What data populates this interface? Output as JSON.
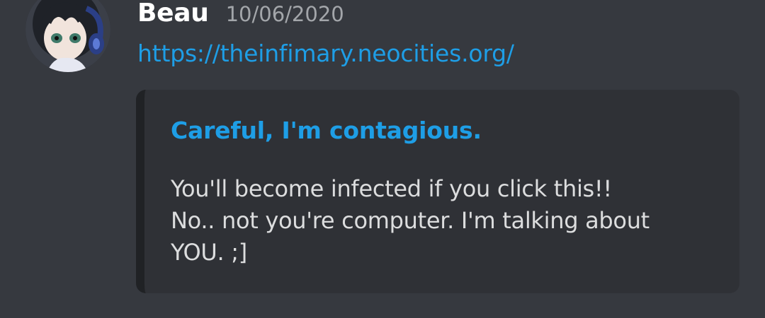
{
  "message": {
    "author": {
      "name": "Beau",
      "avatar_icon": "anime-avatar-icon"
    },
    "timestamp": "10/06/2020",
    "link_text": "https://theinfimary.neocities.org/",
    "embed": {
      "title": "Careful, I'm contagious.",
      "description_lines": [
        "You'll become infected if you click this!!",
        "No.. not you're computer. I'm talking about",
        "YOU. ;]"
      ]
    }
  },
  "colors": {
    "background": "#36393f",
    "embed_background": "#2f3136",
    "embed_border": "#202225",
    "link": "#1e9ee6",
    "username": "#ffffff",
    "timestamp": "#a3a6aa",
    "text": "#dcddde"
  }
}
